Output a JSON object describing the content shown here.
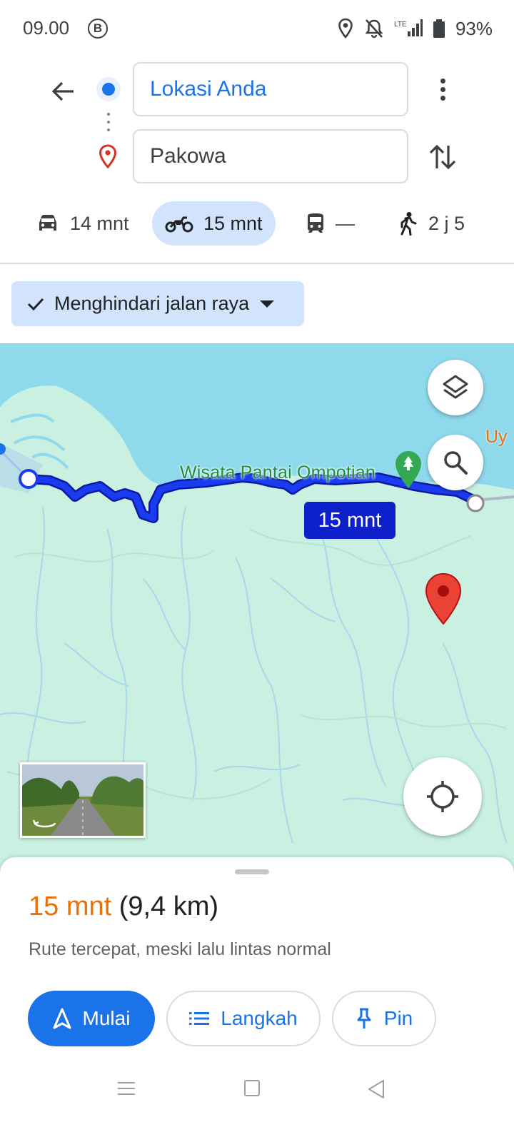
{
  "status_bar": {
    "time": "09.00",
    "b_icon": "B",
    "lte_label": "LTE",
    "battery": "93%"
  },
  "directions": {
    "origin": "Lokasi Anda",
    "destination": "Pakowa"
  },
  "travel_modes": [
    {
      "icon": "car-icon",
      "label": "14 mnt"
    },
    {
      "icon": "motorcycle-icon",
      "label": "15 mnt",
      "selected": true
    },
    {
      "icon": "transit-icon",
      "label": "—"
    },
    {
      "icon": "walk-icon",
      "label": "2 j 5"
    }
  ],
  "chip": {
    "label": "Menghindari jalan raya"
  },
  "map": {
    "poi_label": "Wisata Pantai Ompotian",
    "edge_label": "Uy",
    "route_badge": "15 mnt"
  },
  "summary": {
    "duration": "15 mnt",
    "distance": "(9,4 km)",
    "note": "Rute tercepat, meski lalu lintas normal"
  },
  "actions": {
    "start": "Mulai",
    "steps": "Langkah",
    "pin": "Pin"
  },
  "colors": {
    "accent": "#1a73e8",
    "route": "#0d20c9",
    "duration": "#e8710a",
    "water": "#8fd9ec",
    "land": "#c9f0e0"
  }
}
